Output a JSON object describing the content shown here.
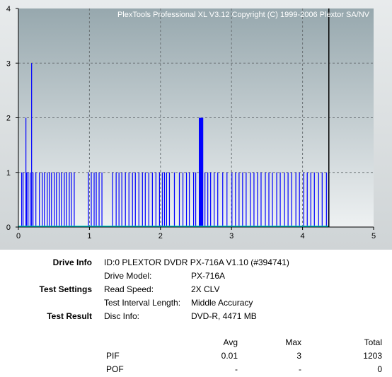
{
  "chart_data": {
    "type": "bar",
    "title": "PlexTools Professional XL V3.12 Copyright (C) 1999-2006 Plextor SA/NV",
    "xlim": [
      0,
      5
    ],
    "ylim": [
      0,
      4
    ],
    "x_ticks": [
      "0",
      "1",
      "2",
      "3",
      "4",
      "5"
    ],
    "y_ticks": [
      "0",
      "1",
      "2",
      "3",
      "4"
    ],
    "grid": true,
    "disc_end_x": 4.37,
    "series": [
      {
        "name": "PIF",
        "color": "#0000ff",
        "x": [
          0.04,
          0.06,
          0.1,
          0.11,
          0.13,
          0.16,
          0.18,
          0.2,
          0.24,
          0.29,
          0.33,
          0.36,
          0.4,
          0.43,
          0.46,
          0.5,
          0.53,
          0.57,
          0.6,
          0.64,
          0.67,
          0.71,
          0.74,
          0.78,
          0.98,
          1.02,
          1.06,
          1.09,
          1.13,
          1.17,
          1.32,
          1.37,
          1.41,
          1.45,
          1.5,
          1.55,
          1.6,
          1.64,
          1.69,
          1.74,
          1.78,
          1.83,
          1.88,
          1.93,
          1.98,
          2.02,
          2.05,
          2.08,
          2.12,
          2.19,
          2.26,
          2.31,
          2.36,
          2.4,
          2.46,
          2.49,
          2.54,
          2.55,
          2.56,
          2.57,
          2.58,
          2.59,
          2.62,
          2.66,
          2.7,
          2.75,
          2.8,
          2.87,
          2.93,
          3.0,
          3.05,
          3.1,
          3.15,
          3.2,
          3.26,
          3.31,
          3.36,
          3.41,
          3.47,
          3.52,
          3.57,
          3.63,
          3.68,
          3.74,
          3.79,
          3.84,
          3.9,
          3.95,
          4.01,
          4.06,
          4.11,
          4.16,
          4.22,
          4.27,
          4.33,
          4.36
        ],
        "values": [
          1,
          1,
          2,
          1,
          1,
          1,
          3,
          1,
          1,
          1,
          1,
          1,
          1,
          1,
          1,
          1,
          1,
          1,
          1,
          1,
          1,
          1,
          1,
          1,
          1,
          1,
          1,
          1,
          1,
          1,
          1,
          1,
          1,
          1,
          1,
          1,
          1,
          1,
          1,
          1,
          1,
          1,
          1,
          1,
          1,
          1,
          1,
          1,
          1,
          1,
          1,
          1,
          1,
          1,
          1,
          1,
          2,
          2,
          2,
          2,
          2,
          2,
          1,
          1,
          1,
          1,
          1,
          1,
          1,
          1,
          1,
          1,
          1,
          1,
          1,
          1,
          1,
          1,
          1,
          1,
          1,
          1,
          1,
          1,
          1,
          1,
          1,
          1,
          1,
          1,
          1,
          1,
          1,
          1,
          1,
          1
        ]
      },
      {
        "name": "POF",
        "color": "#00c8c8",
        "x": [
          0,
          4.37
        ],
        "values": [
          0,
          0
        ]
      }
    ]
  },
  "info": {
    "drive_info_header": "Drive Info",
    "drive_id": "ID:0 PLEXTOR DVDR  PX-716A  V1.10 (#394741)",
    "drive_model_label": "Drive Model:",
    "drive_model_value": "PX-716A",
    "test_settings_header": "Test Settings",
    "read_speed_label": "Read Speed:",
    "read_speed_value": "2X CLV",
    "interval_label": "Test Interval Length:",
    "interval_value": "Middle Accuracy",
    "test_result_header": "Test Result",
    "disc_info_label": "Disc Info:",
    "disc_info_value": "DVD-R, 4471 MB"
  },
  "results": {
    "headers": [
      "Avg",
      "Max",
      "Total"
    ],
    "rows": [
      {
        "label": "PIF",
        "avg": "0.01",
        "max": "3",
        "total": "1203"
      },
      {
        "label": "POF",
        "avg": "-",
        "max": "-",
        "total": "0"
      }
    ]
  }
}
